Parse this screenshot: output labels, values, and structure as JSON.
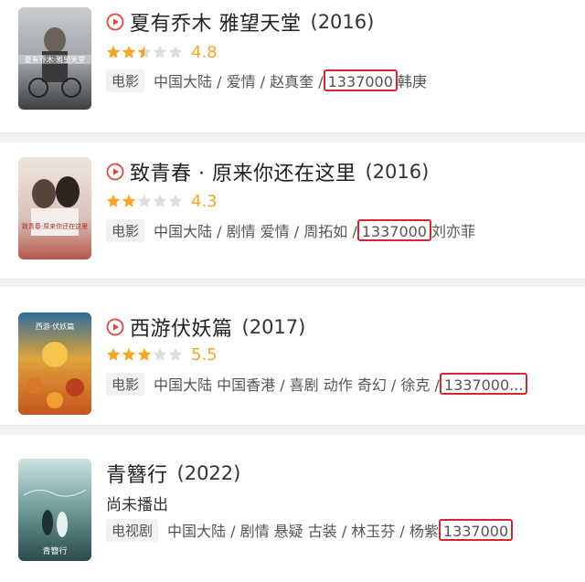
{
  "colors": {
    "star_filled": "#f6a623",
    "star_empty": "#dcdcdc",
    "score": "#f6a623",
    "play_icon": "#e8443a",
    "highlight_box": "#d9252b",
    "background": "#f3f3f3"
  },
  "movies": [
    {
      "title": "夏有乔木 雅望天堂",
      "year": "(2016)",
      "has_play_icon": true,
      "stars": 2.5,
      "score": "4.8",
      "type_tag": "电影",
      "info": "中国大陆 / 爱情 / 赵真奎 /",
      "boxed": "1337000",
      "after": "韩庚",
      "poster_caption": "夏有乔木·雅望天堂"
    },
    {
      "title": "致青春 · 原来你还在这里",
      "year": "(2016)",
      "has_play_icon": true,
      "stars": 2,
      "score": "4.3",
      "type_tag": "电影",
      "info": "中国大陆 / 剧情 爱情 / 周拓如 /",
      "boxed": "1337000",
      "after": "刘亦菲",
      "poster_caption": "致青春·原来你还在这里"
    },
    {
      "title": "西游伏妖篇",
      "year": "(2017)",
      "has_play_icon": true,
      "stars": 3,
      "score": "5.5",
      "type_tag": "电影",
      "info": "中国大陆 中国香港 / 喜剧 动作 奇幻 / 徐克 /",
      "boxed": "1337000...",
      "after": "",
      "poster_caption": "西游·伏妖篇"
    },
    {
      "title": "青簪行",
      "year": "(2022)",
      "has_play_icon": false,
      "subtitle": "尚未播出",
      "type_tag": "电视剧",
      "info": "中国大陆 / 剧情 悬疑 古装 / 林玉芬 / 杨紫",
      "boxed": "1337000",
      "after": "",
      "poster_caption": "青簪行"
    }
  ]
}
